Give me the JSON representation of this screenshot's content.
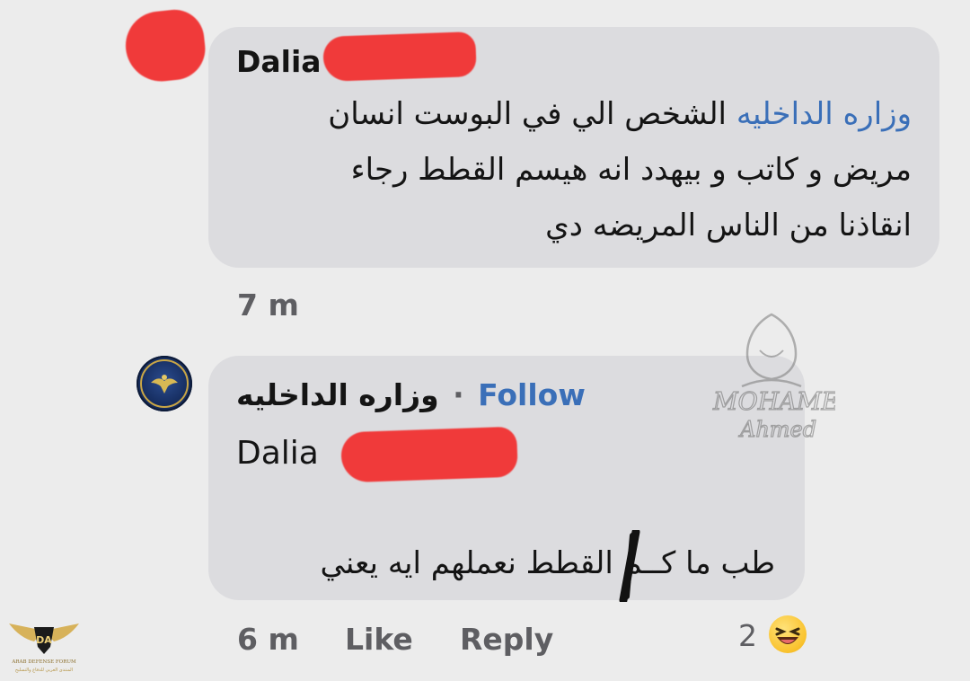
{
  "comment1": {
    "author": "Dalia",
    "mention": "وزاره الداخليه",
    "line1_rest": "الشخص الي في البوست انسان",
    "line2": "مريض و كاتب و بيهدد انه هيسم القطط رجاء",
    "line3": "انقاذنا من الناس المريضه دي",
    "time": "7 m"
  },
  "reply": {
    "author": "وزاره الداخليه",
    "separator": "·",
    "follow_label": "Follow",
    "tagged_name": "Dalia",
    "text_part1": "طب ما كـ",
    "text_part2": "ـم القطط نعملهم ايه يعني",
    "time": "6 m",
    "like_label": "Like",
    "reply_label": "Reply",
    "reaction_count": "2",
    "reaction_icon": "laughing-emoji-icon"
  },
  "watermark": {
    "line1": "MOHAMED",
    "line2": "Ahmed"
  },
  "corner_logo": {
    "letters": "DA",
    "caption": "ARAB DEFENSE FORUM",
    "caption2": "المنتدى العربي للدفاع والتسليح"
  },
  "colors": {
    "background": "#ececec",
    "bubble": "#dcdcdf",
    "mention_blue": "#3a6fb8",
    "redaction_red": "#f03a3a",
    "meta_gray": "#5e5e62"
  }
}
